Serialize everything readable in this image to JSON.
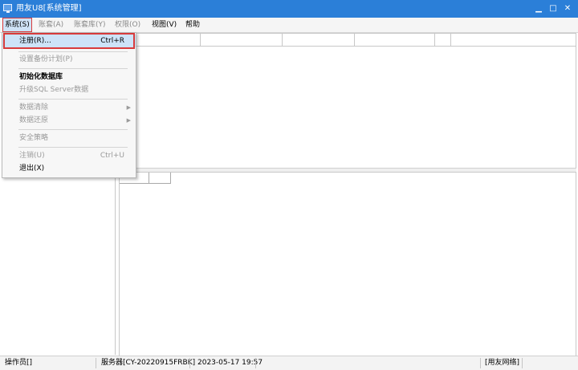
{
  "window": {
    "title": "用友U8[系统管理]",
    "controls": {
      "minimize": "▁",
      "maximize": "□",
      "close": "✕"
    },
    "accent": "#2b7fd8"
  },
  "menubar": {
    "items": [
      {
        "label": "系统(S)",
        "state": "active"
      },
      {
        "label": "账套(A)",
        "state": "disabled"
      },
      {
        "label": "账套库(Y)",
        "state": "disabled"
      },
      {
        "label": "权限(O)",
        "state": "disabled"
      },
      {
        "label": "视图(V)",
        "state": "enabled"
      },
      {
        "label": "帮助",
        "state": "enabled"
      }
    ]
  },
  "dropdown": {
    "items": [
      {
        "label": "注册(R)...",
        "shortcut": "Ctrl+R",
        "state": "highlight"
      },
      {
        "label": "设置备份计划(P)",
        "shortcut": "",
        "state": "disabled"
      },
      {
        "label": "初始化数据库",
        "shortcut": "",
        "state": "bold"
      },
      {
        "label": "升级SQL Server数据",
        "shortcut": "",
        "state": "disabled"
      },
      {
        "label": "数据清除",
        "shortcut": "",
        "state": "disabled",
        "submenu": "▶"
      },
      {
        "label": "数据还原",
        "shortcut": "",
        "state": "disabled",
        "submenu": "▶"
      },
      {
        "label": "安全策略",
        "shortcut": "",
        "state": "disabled"
      },
      {
        "label": "注销(U)",
        "shortcut": "Ctrl+U",
        "state": "disabled"
      },
      {
        "label": "退出(X)",
        "shortcut": "",
        "state": "enabled"
      }
    ],
    "highlight_color": "#d83b3b"
  },
  "statusbar": {
    "operator": "操作员[]",
    "server": "服务器[CY-20220915FRBK]",
    "datetime": "2023-05-17 19:57",
    "network": "[用友网络]"
  }
}
